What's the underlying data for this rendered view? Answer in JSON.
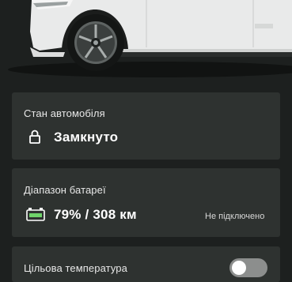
{
  "vehicle_status": {
    "title": "Стан автомобіля",
    "lock_icon": "lock-icon",
    "value": "Замкнуто"
  },
  "battery": {
    "title": "Діапазон батареї",
    "icon": "battery-icon",
    "value": "79% / 308 км",
    "charging_status": "Не підключено"
  },
  "target_temperature": {
    "title": "Цільова температура",
    "enabled": false
  },
  "colors": {
    "background": "#1d201f",
    "card": "#2e3230",
    "battery_accent": "#6fd36a",
    "toggle_off": "#8c8e8d"
  }
}
